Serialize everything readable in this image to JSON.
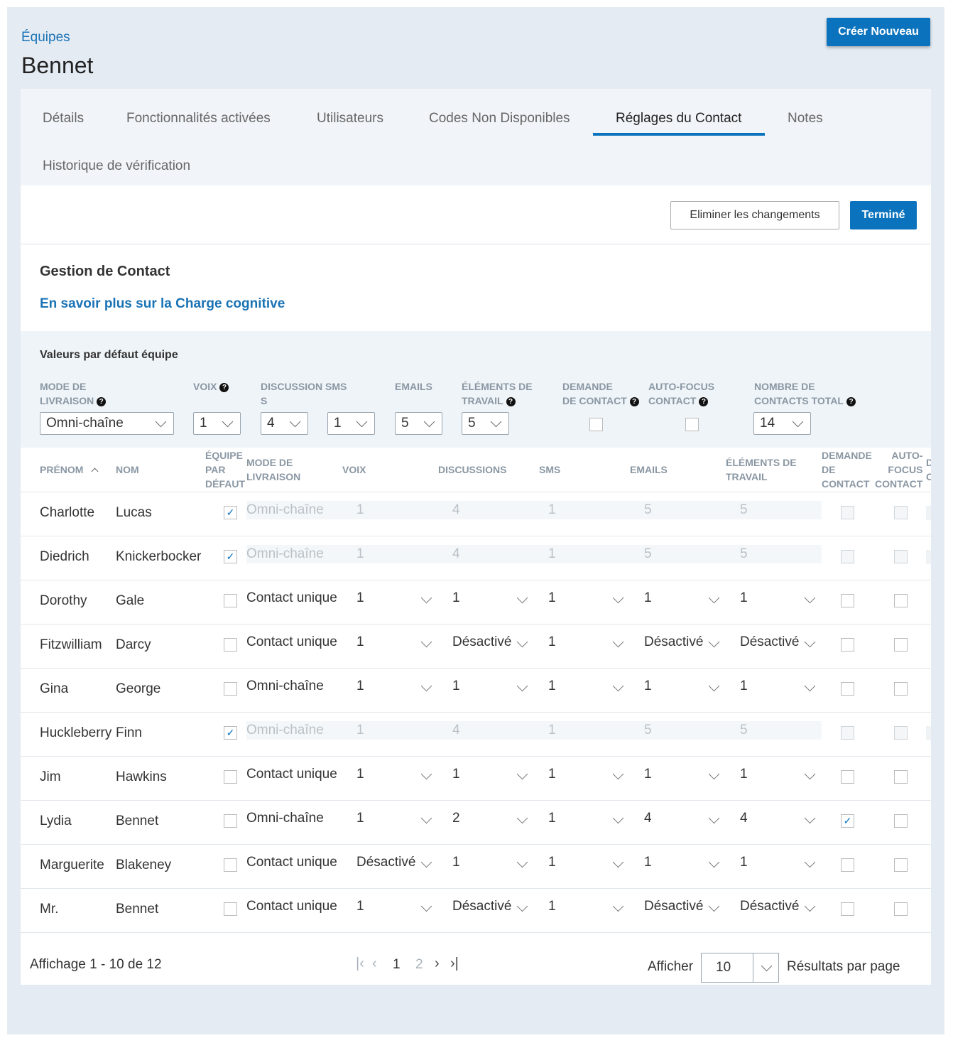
{
  "breadcrumb": "Équipes",
  "page_title": "Bennet",
  "create_button": "Créer Nouveau",
  "tabs": [
    "Détails",
    "Fonctionnalités activées",
    "Utilisateurs",
    "Codes Non Disponibles",
    "Réglages du Contact",
    "Notes",
    "Historique de vérification"
  ],
  "active_tab": "Réglages du Contact",
  "actions": {
    "discard": "Eliminer les changements",
    "done": "Terminé"
  },
  "section": {
    "title": "Gestion de Contact",
    "link": "En savoir plus sur la Charge cognitive"
  },
  "defaults": {
    "title": "Valeurs par défaut équipe",
    "labels": {
      "delivery_1": "MODE DE",
      "delivery_2": "LIVRAISON",
      "voice": "VOIX",
      "chat_1": "DISCUSSION SMS",
      "chat_2": "S",
      "emails": "EMAILS",
      "work_1": "ÉLÉMENTS DE",
      "work_2": "TRAVAIL",
      "request_1": "DEMANDE",
      "request_2": "DE CONTACT",
      "autofocus_1": "AUTO-FOCUS",
      "autofocus_2": "CONTACT",
      "total_1": "NOMBRE DE",
      "total_2": "CONTACTS TOTAL"
    },
    "values": {
      "delivery": "Omni-chaîne",
      "voice": "1",
      "discussions": "4",
      "sms": "1",
      "emails": "5",
      "work": "5",
      "total": "14"
    },
    "help_glyph": "?"
  },
  "table": {
    "headers": {
      "first": "PRÉNOM",
      "last": "NOM",
      "default_1": "ÉQUIPE",
      "default_2": "PAR",
      "default_3": "DÉFAUT",
      "delivery_1": "MODE DE",
      "delivery_2": "LIVRAISON",
      "voice": "VOIX",
      "discussions": "DISCUSSIONS",
      "sms": "SMS",
      "emails": "EMAILS",
      "work_1": "ÉLÉMENTS DE",
      "work_2": "TRAVAIL",
      "request_1": "DEMANDE",
      "request_2": "DE",
      "request_3": "CONTACT",
      "autofocus_1": "AUTO-",
      "autofocus_2": "FOCUS",
      "autofocus_3": "CONTACT",
      "extra_1": "D",
      "extra_2": "C"
    },
    "rows": [
      {
        "first": "Charlotte",
        "last": "Lucas",
        "team_default": true,
        "mode": "Omni-chaîne",
        "voice": "1",
        "discussions": "4",
        "sms": "1",
        "emails": "5",
        "work": "5",
        "request": false,
        "autofocus": false
      },
      {
        "first": "Diedrich",
        "last": "Knickerbocker",
        "team_default": true,
        "mode": "Omni-chaîne",
        "voice": "1",
        "discussions": "4",
        "sms": "1",
        "emails": "5",
        "work": "5",
        "request": false,
        "autofocus": false
      },
      {
        "first": "Dorothy",
        "last": "Gale",
        "team_default": false,
        "mode": "Contact unique",
        "voice": "1",
        "discussions": "1",
        "sms": "1",
        "emails": "1",
        "work": "1",
        "request": false,
        "autofocus": false
      },
      {
        "first": "Fitzwilliam",
        "last": "Darcy",
        "team_default": false,
        "mode": "Contact unique",
        "voice": "1",
        "discussions": "Désactivé",
        "sms": "1",
        "emails": "Désactivé",
        "work": "Désactivé",
        "request": false,
        "autofocus": false
      },
      {
        "first": "Gina",
        "last": "George",
        "team_default": false,
        "mode": "Omni-chaîne",
        "voice": "1",
        "discussions": "1",
        "sms": "1",
        "emails": "1",
        "work": "1",
        "request": false,
        "autofocus": false
      },
      {
        "first": "Huckleberry",
        "last": "Finn",
        "team_default": true,
        "mode": "Omni-chaîne",
        "voice": "1",
        "discussions": "4",
        "sms": "1",
        "emails": "5",
        "work": "5",
        "request": false,
        "autofocus": false
      },
      {
        "first": "Jim",
        "last": "Hawkins",
        "team_default": false,
        "mode": "Contact unique",
        "voice": "1",
        "discussions": "1",
        "sms": "1",
        "emails": "1",
        "work": "1",
        "request": false,
        "autofocus": false
      },
      {
        "first": "Lydia",
        "last": "Bennet",
        "team_default": false,
        "mode": "Omni-chaîne",
        "voice": "1",
        "discussions": "2",
        "sms": "1",
        "emails": "4",
        "work": "4",
        "request": true,
        "autofocus": false
      },
      {
        "first": "Marguerite",
        "last": "Blakeney",
        "team_default": false,
        "mode": "Contact unique",
        "voice": "Désactivé",
        "discussions": "1",
        "sms": "1",
        "emails": "1",
        "work": "1",
        "request": false,
        "autofocus": false
      },
      {
        "first": "Mr.",
        "last": "Bennet",
        "team_default": false,
        "mode": "Contact unique",
        "voice": "1",
        "discussions": "Désactivé",
        "sms": "1",
        "emails": "Désactivé",
        "work": "Désactivé",
        "request": false,
        "autofocus": false
      }
    ]
  },
  "footer": {
    "showing": "Affichage 1 - 10 de 12",
    "pages": [
      "1",
      "2"
    ],
    "current_page": "1",
    "show_label": "Afficher",
    "per_page": "10",
    "per_page_label": "Résultats par page"
  },
  "colors": {
    "accent": "#0b73bd",
    "link": "#1a73b5",
    "background": "#e4ebf3"
  }
}
